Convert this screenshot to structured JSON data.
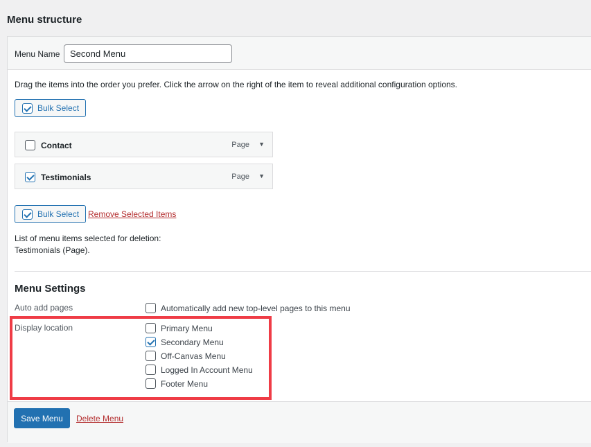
{
  "page_title": "Menu structure",
  "menu_name": {
    "label": "Menu Name",
    "value": "Second Menu"
  },
  "instructions": "Drag the items into the order you prefer. Click the arrow on the right of the item to reveal additional configuration options.",
  "bulk_select_label": "Bulk Select",
  "menu_items": [
    {
      "title": "Contact",
      "type": "Page",
      "checked": false
    },
    {
      "title": "Testimonials",
      "type": "Page",
      "checked": true
    }
  ],
  "remove_selected_label": "Remove Selected Items",
  "deletion_list": {
    "heading": "List of menu items selected for deletion:",
    "items": "Testimonials (Page)."
  },
  "menu_settings": {
    "title": "Menu Settings",
    "auto_add": {
      "label": "Auto add pages",
      "option": "Automatically add new top-level pages to this menu",
      "checked": false
    },
    "display_location": {
      "label": "Display location",
      "options": [
        {
          "label": "Primary Menu",
          "checked": false
        },
        {
          "label": "Secondary Menu",
          "checked": true
        },
        {
          "label": "Off-Canvas Menu",
          "checked": false
        },
        {
          "label": "Logged In Account Menu",
          "checked": false
        },
        {
          "label": "Footer Menu",
          "checked": false
        }
      ]
    }
  },
  "footer": {
    "save_label": "Save Menu",
    "delete_label": "Delete Menu"
  },
  "colors": {
    "accent": "#2271b1",
    "danger": "#b32d2e",
    "highlight": "#ef3c46"
  }
}
